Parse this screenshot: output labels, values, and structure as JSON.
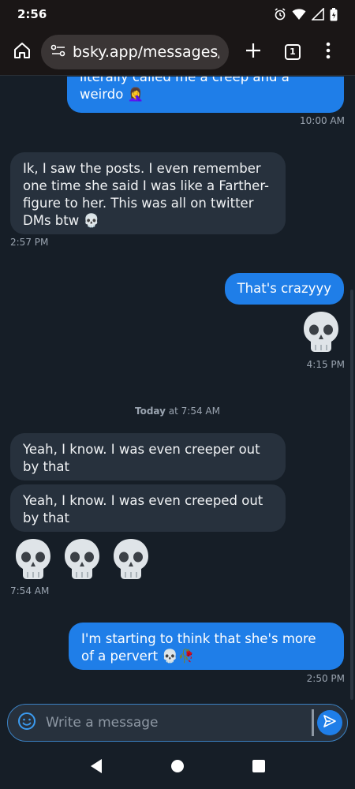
{
  "status": {
    "time": "2:56"
  },
  "browser": {
    "url": "bsky.app/messages/3lsf.",
    "tab_count": "1"
  },
  "messages": [
    {
      "dir": "out",
      "text": "literally called me a creep and a weirdo 🤦‍♀️",
      "time": "10:00 AM"
    },
    {
      "dir": "in",
      "text": "Ik, I saw the posts. I even remember one time she said I was like a Farther-figure to her. This was all on twitter DMs btw 💀",
      "time": "2:57 PM"
    },
    {
      "dir": "out",
      "text": "That's crazyyy"
    },
    {
      "dir": "out",
      "emoji": "💀",
      "time": "4:15 PM"
    },
    {
      "dir": "in",
      "text": "Yeah, I know. I was even creeper out by that"
    },
    {
      "dir": "in",
      "text": "Yeah, I know. I was even creeped out by that"
    },
    {
      "dir": "in",
      "emoji": "💀💀💀",
      "time": "7:54 AM"
    },
    {
      "dir": "out",
      "text": "I'm starting to think that she's more of a pervert 💀🥀",
      "time": "2:50 PM"
    }
  ],
  "day_separator": {
    "day": "Today",
    "time": "at 7:54 AM"
  },
  "composer": {
    "placeholder": "Write a message"
  }
}
